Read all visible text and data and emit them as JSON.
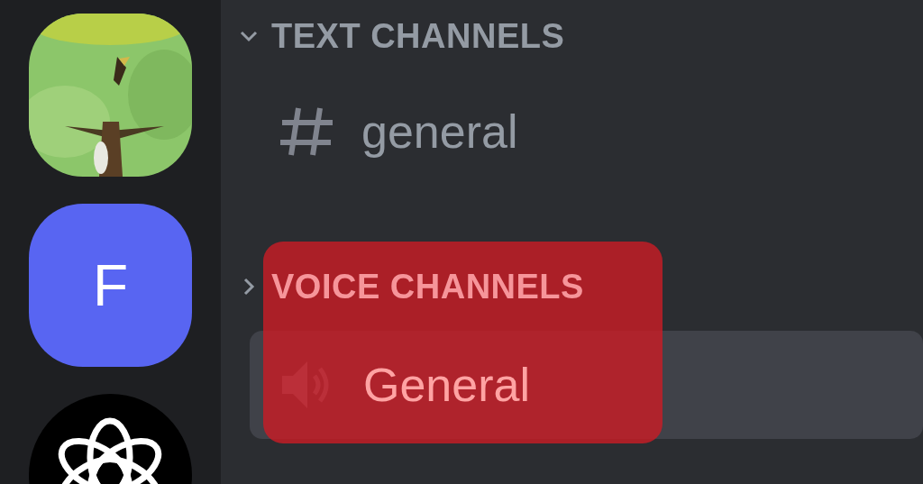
{
  "servers": [
    {
      "kind": "picture"
    },
    {
      "kind": "letter",
      "label": "F"
    },
    {
      "kind": "logo"
    }
  ],
  "categories": [
    {
      "title": "TEXT CHANNELS",
      "expanded": true,
      "channels": [
        {
          "kind": "text",
          "name": "general",
          "selected": false
        }
      ]
    },
    {
      "title": "VOICE CHANNELS",
      "expanded": false,
      "channels": [
        {
          "kind": "voice",
          "name": "General",
          "selected": true
        }
      ]
    }
  ],
  "annotations": [
    {
      "kind": "box"
    }
  ]
}
